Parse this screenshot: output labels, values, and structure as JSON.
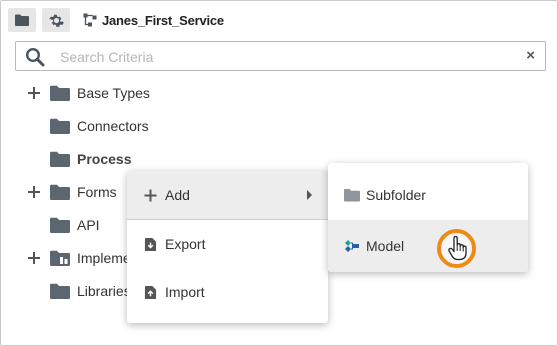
{
  "toolbar": {
    "folder_button_icon": "folder-icon",
    "settings_button_icon": "gear-icon",
    "service_icon": "service-icon",
    "service_name": "Janes_First_Service"
  },
  "search": {
    "placeholder": "Search Criteria",
    "value": "",
    "clear_label": "×"
  },
  "tree": {
    "items": [
      {
        "label": "Base Types",
        "expandable": true,
        "bold": false
      },
      {
        "label": "Connectors",
        "expandable": false,
        "bold": false
      },
      {
        "label": "Process",
        "expandable": false,
        "bold": true
      },
      {
        "label": "Forms",
        "expandable": true,
        "bold": false
      },
      {
        "label": "API",
        "expandable": false,
        "bold": false
      },
      {
        "label": "Impleme",
        "expandable": true,
        "bold": false
      },
      {
        "label": "Libraries",
        "expandable": false,
        "bold": false
      }
    ]
  },
  "context_menu": {
    "items": [
      {
        "label": "Add",
        "icon": "plus-icon",
        "has_submenu": true,
        "highlighted": true
      },
      {
        "label": "Export",
        "icon": "export-icon",
        "has_submenu": false,
        "highlighted": false
      },
      {
        "label": "Import",
        "icon": "import-icon",
        "has_submenu": false,
        "highlighted": false
      }
    ]
  },
  "submenu": {
    "items": [
      {
        "label": "Subfolder",
        "icon": "folder-icon",
        "highlighted": false
      },
      {
        "label": "Model",
        "icon": "model-icon",
        "highlighted": true
      }
    ]
  },
  "colors": {
    "folder": "#5b6670",
    "cursor_ring": "#f08a16",
    "menu_highlight": "#ededed",
    "model_icon_teal": "#1aa39a",
    "model_icon_blue": "#2b5fa8"
  }
}
